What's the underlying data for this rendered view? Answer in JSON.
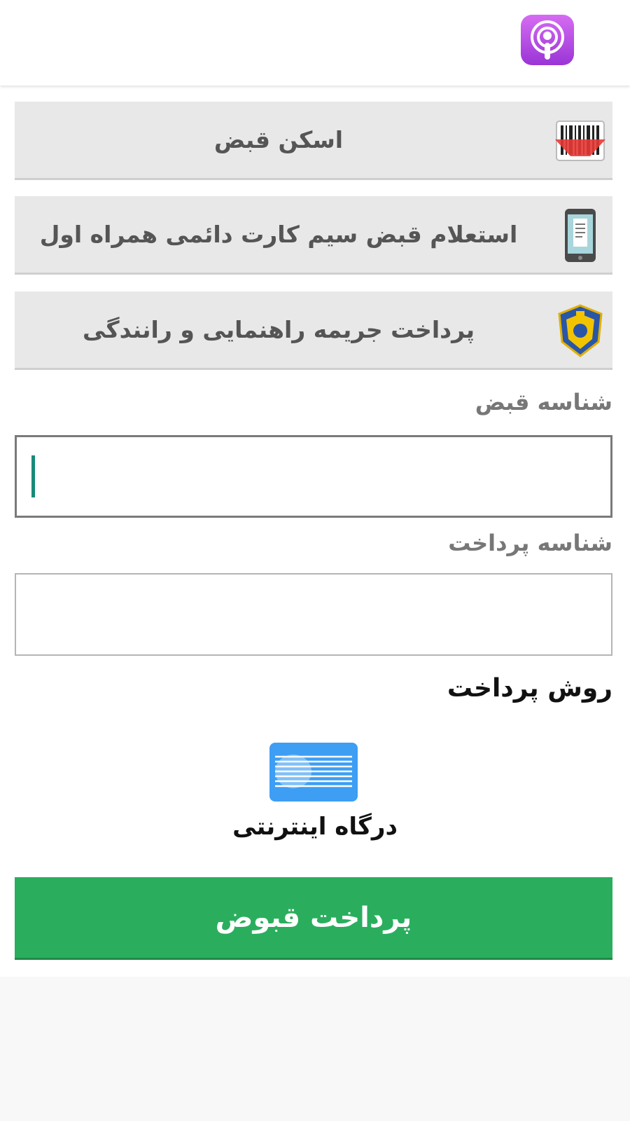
{
  "header": {
    "app_icon": "podcast-icon",
    "app_icon_colors": [
      "#d66cf2",
      "#9a35d6"
    ]
  },
  "menu": {
    "items": [
      {
        "label": "اسکن قبض",
        "icon": "barcode-scanner-icon"
      },
      {
        "label": "استعلام قبض سیم کارت دائمی همراه اول",
        "icon": "mobile-bill-icon"
      },
      {
        "label": "پرداخت جریمه راهنمایی و رانندگی",
        "icon": "traffic-police-badge-icon"
      }
    ]
  },
  "form": {
    "bill_id_label": "شناسه قبض",
    "bill_id_value": "",
    "payment_id_label": "شناسه پرداخت",
    "payment_id_value": ""
  },
  "payment_method": {
    "title": "روش پرداخت",
    "gateway_label": "درگاه اینترنتی",
    "gateway_icon": "internet-gateway-icon",
    "gateway_color": "#3d9ef4"
  },
  "submit": {
    "label": "پرداخت قبوض",
    "color": "#2aae5e"
  }
}
